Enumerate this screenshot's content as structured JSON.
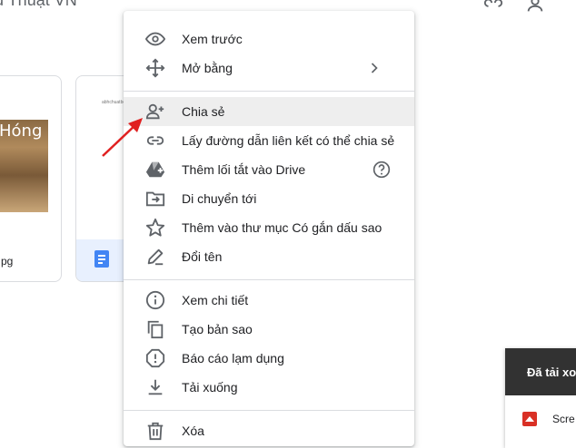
{
  "page": {
    "title": "u Thuật VN"
  },
  "files": [
    {
      "image_text": "Hóng",
      "name_fragment": "pg"
    },
    {
      "thumb_text": "abhchuatbé"
    }
  ],
  "menu": {
    "items": [
      {
        "label": "Xem trước",
        "icon": "eye-icon"
      },
      {
        "label": "Mở bằng",
        "icon": "move-icon",
        "submenu": true
      },
      {
        "label": "Chia sẻ",
        "icon": "add-person-icon",
        "highlighted": true
      },
      {
        "label": "Lấy đường dẫn liên kết có thể chia sẻ",
        "icon": "link-icon"
      },
      {
        "label": "Thêm lối tắt vào Drive",
        "icon": "drive-shortcut-icon",
        "help": true
      },
      {
        "label": "Di chuyển tới",
        "icon": "folder-move-icon"
      },
      {
        "label": "Thêm vào thư mục Có gắn dấu sao",
        "icon": "star-icon"
      },
      {
        "label": "Đổi tên",
        "icon": "pencil-icon"
      },
      {
        "label": "Xem chi tiết",
        "icon": "info-icon"
      },
      {
        "label": "Tạo bản sao",
        "icon": "copy-icon"
      },
      {
        "label": "Báo cáo lạm dụng",
        "icon": "report-icon"
      },
      {
        "label": "Tải xuống",
        "icon": "download-icon"
      },
      {
        "label": "Xóa",
        "icon": "trash-icon"
      }
    ]
  },
  "download_panel": {
    "title": "Đã tải xo",
    "file": "Scre"
  },
  "colors": {
    "annotation_arrow": "#e02020",
    "toast_header": "#323232",
    "hover": "#eeeeee"
  }
}
